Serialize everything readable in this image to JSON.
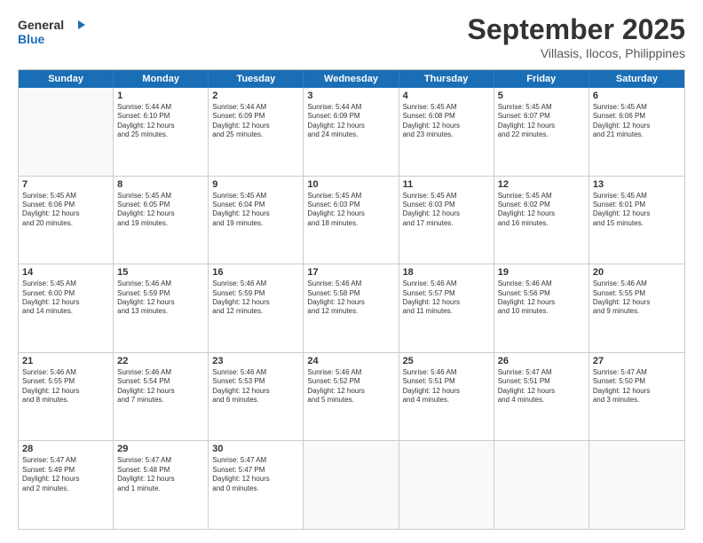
{
  "logo": {
    "line1": "General",
    "line2": "Blue"
  },
  "title": "September 2025",
  "subtitle": "Villasis, Ilocos, Philippines",
  "days": [
    "Sunday",
    "Monday",
    "Tuesday",
    "Wednesday",
    "Thursday",
    "Friday",
    "Saturday"
  ],
  "weeks": [
    [
      {
        "day": "",
        "content": ""
      },
      {
        "day": "1",
        "content": "Sunrise: 5:44 AM\nSunset: 6:10 PM\nDaylight: 12 hours\nand 25 minutes."
      },
      {
        "day": "2",
        "content": "Sunrise: 5:44 AM\nSunset: 6:09 PM\nDaylight: 12 hours\nand 25 minutes."
      },
      {
        "day": "3",
        "content": "Sunrise: 5:44 AM\nSunset: 6:09 PM\nDaylight: 12 hours\nand 24 minutes."
      },
      {
        "day": "4",
        "content": "Sunrise: 5:45 AM\nSunset: 6:08 PM\nDaylight: 12 hours\nand 23 minutes."
      },
      {
        "day": "5",
        "content": "Sunrise: 5:45 AM\nSunset: 6:07 PM\nDaylight: 12 hours\nand 22 minutes."
      },
      {
        "day": "6",
        "content": "Sunrise: 5:45 AM\nSunset: 6:06 PM\nDaylight: 12 hours\nand 21 minutes."
      }
    ],
    [
      {
        "day": "7",
        "content": "Sunrise: 5:45 AM\nSunset: 6:06 PM\nDaylight: 12 hours\nand 20 minutes."
      },
      {
        "day": "8",
        "content": "Sunrise: 5:45 AM\nSunset: 6:05 PM\nDaylight: 12 hours\nand 19 minutes."
      },
      {
        "day": "9",
        "content": "Sunrise: 5:45 AM\nSunset: 6:04 PM\nDaylight: 12 hours\nand 19 minutes."
      },
      {
        "day": "10",
        "content": "Sunrise: 5:45 AM\nSunset: 6:03 PM\nDaylight: 12 hours\nand 18 minutes."
      },
      {
        "day": "11",
        "content": "Sunrise: 5:45 AM\nSunset: 6:03 PM\nDaylight: 12 hours\nand 17 minutes."
      },
      {
        "day": "12",
        "content": "Sunrise: 5:45 AM\nSunset: 6:02 PM\nDaylight: 12 hours\nand 16 minutes."
      },
      {
        "day": "13",
        "content": "Sunrise: 5:45 AM\nSunset: 6:01 PM\nDaylight: 12 hours\nand 15 minutes."
      }
    ],
    [
      {
        "day": "14",
        "content": "Sunrise: 5:45 AM\nSunset: 6:00 PM\nDaylight: 12 hours\nand 14 minutes."
      },
      {
        "day": "15",
        "content": "Sunrise: 5:46 AM\nSunset: 5:59 PM\nDaylight: 12 hours\nand 13 minutes."
      },
      {
        "day": "16",
        "content": "Sunrise: 5:46 AM\nSunset: 5:59 PM\nDaylight: 12 hours\nand 12 minutes."
      },
      {
        "day": "17",
        "content": "Sunrise: 5:46 AM\nSunset: 5:58 PM\nDaylight: 12 hours\nand 12 minutes."
      },
      {
        "day": "18",
        "content": "Sunrise: 5:46 AM\nSunset: 5:57 PM\nDaylight: 12 hours\nand 11 minutes."
      },
      {
        "day": "19",
        "content": "Sunrise: 5:46 AM\nSunset: 5:56 PM\nDaylight: 12 hours\nand 10 minutes."
      },
      {
        "day": "20",
        "content": "Sunrise: 5:46 AM\nSunset: 5:55 PM\nDaylight: 12 hours\nand 9 minutes."
      }
    ],
    [
      {
        "day": "21",
        "content": "Sunrise: 5:46 AM\nSunset: 5:55 PM\nDaylight: 12 hours\nand 8 minutes."
      },
      {
        "day": "22",
        "content": "Sunrise: 5:46 AM\nSunset: 5:54 PM\nDaylight: 12 hours\nand 7 minutes."
      },
      {
        "day": "23",
        "content": "Sunrise: 5:46 AM\nSunset: 5:53 PM\nDaylight: 12 hours\nand 6 minutes."
      },
      {
        "day": "24",
        "content": "Sunrise: 5:46 AM\nSunset: 5:52 PM\nDaylight: 12 hours\nand 5 minutes."
      },
      {
        "day": "25",
        "content": "Sunrise: 5:46 AM\nSunset: 5:51 PM\nDaylight: 12 hours\nand 4 minutes."
      },
      {
        "day": "26",
        "content": "Sunrise: 5:47 AM\nSunset: 5:51 PM\nDaylight: 12 hours\nand 4 minutes."
      },
      {
        "day": "27",
        "content": "Sunrise: 5:47 AM\nSunset: 5:50 PM\nDaylight: 12 hours\nand 3 minutes."
      }
    ],
    [
      {
        "day": "28",
        "content": "Sunrise: 5:47 AM\nSunset: 5:49 PM\nDaylight: 12 hours\nand 2 minutes."
      },
      {
        "day": "29",
        "content": "Sunrise: 5:47 AM\nSunset: 5:48 PM\nDaylight: 12 hours\nand 1 minute."
      },
      {
        "day": "30",
        "content": "Sunrise: 5:47 AM\nSunset: 5:47 PM\nDaylight: 12 hours\nand 0 minutes."
      },
      {
        "day": "",
        "content": ""
      },
      {
        "day": "",
        "content": ""
      },
      {
        "day": "",
        "content": ""
      },
      {
        "day": "",
        "content": ""
      }
    ]
  ]
}
